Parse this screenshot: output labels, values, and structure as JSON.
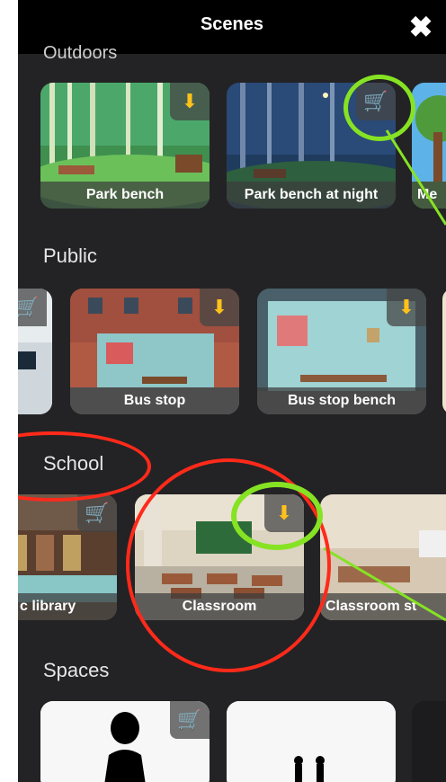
{
  "header": {
    "title": "Scenes",
    "close_icon": "close-icon"
  },
  "sections": {
    "outdoors": {
      "label": "Outdoors"
    },
    "public": {
      "label": "Public"
    },
    "school": {
      "label": "School"
    },
    "spaces": {
      "label": "Spaces"
    }
  },
  "cards": {
    "park_bench": {
      "label": "Park bench",
      "badge": "download-icon"
    },
    "park_bench_night": {
      "label": "Park bench at night",
      "badge": "cart-icon"
    },
    "me": {
      "label": "Me"
    },
    "bus_stop": {
      "label": "Bus stop",
      "badge": "download-icon"
    },
    "bus_stop_bench": {
      "label": "Bus stop bench",
      "badge": "download-icon"
    },
    "public_library": {
      "label": "c library",
      "badge": "cart-icon"
    },
    "classroom": {
      "label": "Classroom",
      "badge": "download-icon"
    },
    "classroom_st": {
      "label": "Classroom st"
    }
  },
  "colors": {
    "accent_badge": "#ffc21a",
    "annotation_green": "#86e323",
    "annotation_red": "#ff2a1a"
  }
}
